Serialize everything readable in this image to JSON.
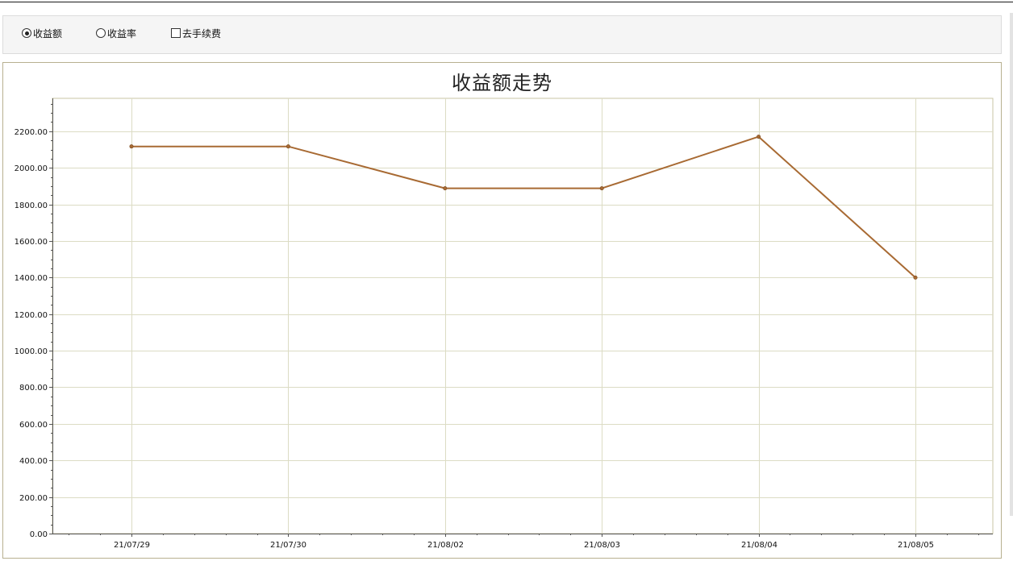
{
  "options": {
    "amount_label": "收益额",
    "rate_label": "收益率",
    "fee_label": "去手续费",
    "selected": "amount",
    "fee_checked": false
  },
  "colors": {
    "line": "#a86a33",
    "grid": "#dcdcc4",
    "axis": "#555555"
  },
  "chart_data": {
    "type": "line",
    "title": "收益额走势",
    "xlabel": "",
    "ylabel": "",
    "categories": [
      "21/07/29",
      "21/07/30",
      "21/08/02",
      "21/08/03",
      "21/08/04",
      "21/08/05"
    ],
    "series": [
      {
        "values": [
          2117,
          2117,
          1888,
          1888,
          2170,
          1400
        ]
      }
    ],
    "ylim": [
      0,
      2380
    ],
    "yticks": [
      0,
      200,
      400,
      600,
      800,
      1000,
      1200,
      1400,
      1600,
      1800,
      2000,
      2200
    ],
    "ytick_format": "0.00",
    "grid": true,
    "legend": "none"
  }
}
